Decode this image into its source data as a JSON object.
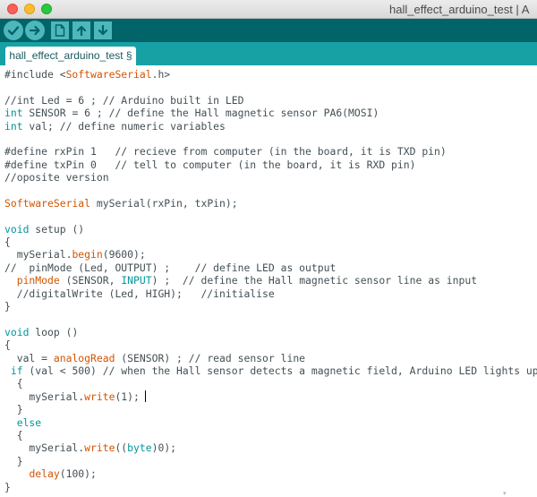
{
  "window": {
    "title": "hall_effect_arduino_test | A"
  },
  "toolbar": {
    "buttons": [
      {
        "name": "verify-button",
        "icon": "checkmark-icon"
      },
      {
        "name": "upload-button",
        "icon": "arrow-right-icon"
      },
      {
        "name": "new-button",
        "icon": "new-file-icon"
      },
      {
        "name": "open-button",
        "icon": "arrow-up-icon"
      },
      {
        "name": "save-button",
        "icon": "arrow-down-icon"
      }
    ]
  },
  "tabs": [
    {
      "label": "hall_effect_arduino_test §",
      "active": true
    }
  ],
  "colors": {
    "toolbar": "#006468",
    "tabstrip": "#17a1a5",
    "keyword": "#00979c",
    "function": "#d35400",
    "text": "#434f54"
  },
  "editor": {
    "lines": [
      [
        {
          "t": "#include <"
        },
        {
          "t": "SoftwareSerial",
          "c": "fn"
        },
        {
          "t": ".h>"
        }
      ],
      [],
      [
        {
          "t": "//int Led = 6 ; // Arduino built in LED"
        }
      ],
      [
        {
          "t": "int",
          "c": "kw"
        },
        {
          "t": " SENSOR = 6 ; // define the Hall magnetic sensor PA6(MOSI)"
        }
      ],
      [
        {
          "t": "int",
          "c": "kw"
        },
        {
          "t": " val; // define numeric variables"
        }
      ],
      [],
      [
        {
          "t": "#define rxPin 1   // recieve from computer (in the board, it is TXD pin)"
        }
      ],
      [
        {
          "t": "#define txPin 0   // tell to computer (in the board, it is RXD pin)"
        }
      ],
      [
        {
          "t": "//oposite version"
        }
      ],
      [],
      [
        {
          "t": "SoftwareSerial",
          "c": "fn"
        },
        {
          "t": " mySerial(rxPin, txPin);"
        }
      ],
      [],
      [
        {
          "t": "void",
          "c": "kw"
        },
        {
          "t": " setup ()"
        }
      ],
      [
        {
          "t": "{"
        }
      ],
      [
        {
          "t": "  mySerial."
        },
        {
          "t": "begin",
          "c": "fn"
        },
        {
          "t": "(9600);"
        }
      ],
      [
        {
          "t": "//  pinMode (Led, OUTPUT) ;    // define LED as output"
        }
      ],
      [
        {
          "t": "  "
        },
        {
          "t": "pinMode",
          "c": "fn"
        },
        {
          "t": " (SENSOR, "
        },
        {
          "t": "INPUT",
          "c": "kw"
        },
        {
          "t": ") ;  // define the Hall magnetic sensor line as input"
        }
      ],
      [
        {
          "t": "  //digitalWrite (Led, HIGH);   //initialise"
        }
      ],
      [
        {
          "t": "}"
        }
      ],
      [],
      [
        {
          "t": "void",
          "c": "kw"
        },
        {
          "t": " loop ()"
        }
      ],
      [
        {
          "t": "{"
        }
      ],
      [
        {
          "t": "  val = "
        },
        {
          "t": "analogRead",
          "c": "fn"
        },
        {
          "t": " (SENSOR) ; // read sensor line"
        }
      ],
      [
        {
          "t": " "
        },
        {
          "t": "if",
          "c": "kw"
        },
        {
          "t": " (val < 500) // when the Hall sensor detects a magnetic field, Arduino LED lights up"
        }
      ],
      [
        {
          "t": "  {"
        }
      ],
      [
        {
          "t": "    mySerial."
        },
        {
          "t": "write",
          "c": "fn"
        },
        {
          "t": "(1);"
        },
        {
          "t": "",
          "caret": true
        }
      ],
      [
        {
          "t": "  }"
        }
      ],
      [
        {
          "t": "  "
        },
        {
          "t": "else",
          "c": "kw"
        }
      ],
      [
        {
          "t": "  {"
        }
      ],
      [
        {
          "t": "    mySerial."
        },
        {
          "t": "write",
          "c": "fn"
        },
        {
          "t": "(("
        },
        {
          "t": "byte",
          "c": "kw"
        },
        {
          "t": ")0);"
        }
      ],
      [
        {
          "t": "  }"
        }
      ],
      [
        {
          "t": "    "
        },
        {
          "t": "delay",
          "c": "fn"
        },
        {
          "t": "(100);"
        }
      ],
      [
        {
          "t": "}"
        }
      ]
    ]
  }
}
